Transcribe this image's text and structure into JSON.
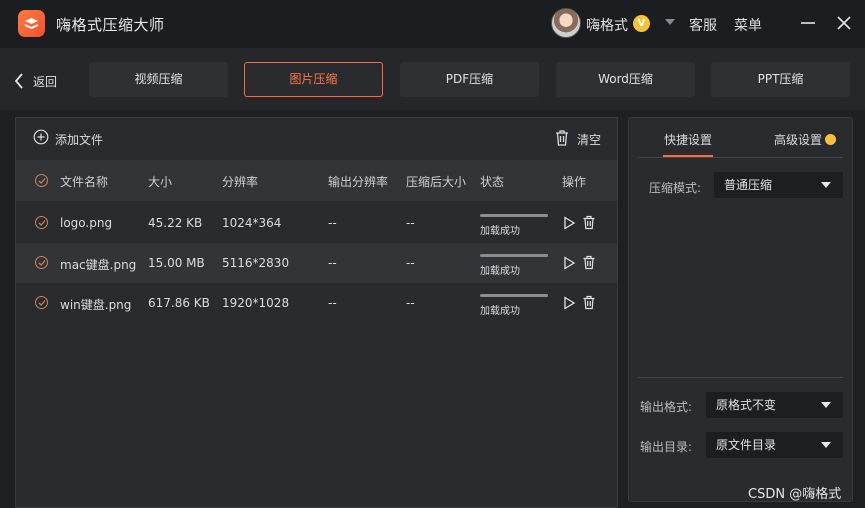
{
  "app": {
    "title": "嗨格式压缩大师",
    "username": "嗨格式",
    "vip_badge": "V",
    "support_label": "客服",
    "menu_label": "菜单"
  },
  "nav": {
    "back_label": "返回",
    "tabs": [
      {
        "label": "视频压缩",
        "active": false
      },
      {
        "label": "图片压缩",
        "active": true
      },
      {
        "label": "PDF压缩",
        "active": false
      },
      {
        "label": "Word压缩",
        "active": false
      },
      {
        "label": "PPT压缩",
        "active": false
      }
    ]
  },
  "toolbar": {
    "add_file_label": "添加文件",
    "clear_label": "清空"
  },
  "table": {
    "headers": [
      "文件名称",
      "大小",
      "分辨率",
      "输出分辨率",
      "压缩后大小",
      "状态",
      "操作"
    ],
    "rows": [
      {
        "name": "logo.png",
        "size": "45.22 KB",
        "resolution": "1024*364",
        "output_resolution": "--",
        "compressed_size": "--",
        "status": "加载成功"
      },
      {
        "name": "mac键盘.png",
        "size": "15.00 MB",
        "resolution": "5116*2830",
        "output_resolution": "--",
        "compressed_size": "--",
        "status": "加载成功"
      },
      {
        "name": "win键盘.png",
        "size": "617.86 KB",
        "resolution": "1920*1028",
        "output_resolution": "--",
        "compressed_size": "--",
        "status": "加载成功"
      }
    ]
  },
  "settings": {
    "tab_quick": "快捷设置",
    "tab_advanced": "高级设置",
    "compress_mode_label": "压缩模式:",
    "compress_mode_value": "普通压缩",
    "output_format_label": "输出格式:",
    "output_format_value": "原格式不变",
    "output_dir_label": "输出目录:",
    "output_dir_value": "原文件目录"
  },
  "watermark": "CSDN @嗨格式",
  "colors": {
    "accent": "#ff6a3a",
    "background": "#1f2023",
    "panel": "#2a2b2e",
    "vip": "#f3c23a"
  }
}
